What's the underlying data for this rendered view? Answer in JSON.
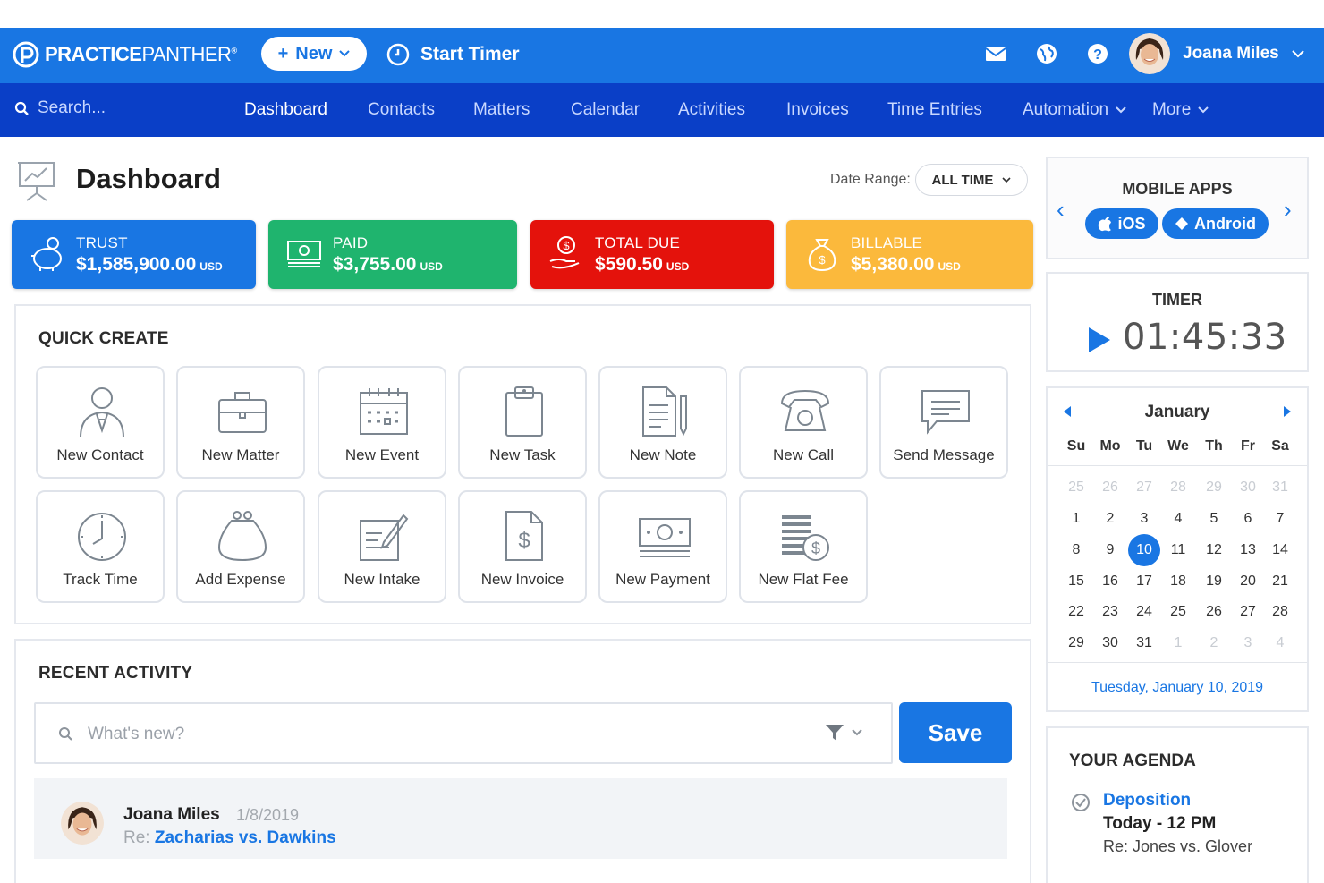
{
  "header": {
    "logo_bold": "PRACTICE",
    "logo_thin": "PANTHER",
    "logo_mark": "®",
    "new_label": "New",
    "start_timer_label": "Start Timer",
    "user_name": "Joana Miles"
  },
  "nav": {
    "search_placeholder": "Search...",
    "items": [
      "Dashboard",
      "Contacts",
      "Matters",
      "Calendar",
      "Activities",
      "Invoices",
      "Time Entries",
      "Automation",
      "More"
    ],
    "active": "Dashboard"
  },
  "dashboard": {
    "title": "Dashboard",
    "date_range_label": "Date Range:",
    "date_range_value": "ALL TIME"
  },
  "stats": [
    {
      "label": "TRUST",
      "value": "$1,585,900.00",
      "unit": "USD",
      "color": "#1976e3"
    },
    {
      "label": "PAID",
      "value": "$3,755.00",
      "unit": "USD",
      "color": "#1fb46e"
    },
    {
      "label": "TOTAL DUE",
      "value": "$590.50",
      "unit": "USD",
      "color": "#e4120c"
    },
    {
      "label": "BILLABLE",
      "value": "$5,380.00",
      "unit": "USD",
      "color": "#fbb93c"
    }
  ],
  "quick_create": {
    "title": "QUICK CREATE",
    "tiles": [
      {
        "label": "New Contact",
        "icon": "contact-icon"
      },
      {
        "label": "New Matter",
        "icon": "briefcase-icon"
      },
      {
        "label": "New Event",
        "icon": "calendar-grid-icon"
      },
      {
        "label": "New Task",
        "icon": "clipboard-icon"
      },
      {
        "label": "New Note",
        "icon": "note-pencil-icon"
      },
      {
        "label": "New Call",
        "icon": "telephone-icon"
      },
      {
        "label": "Send Message",
        "icon": "speech-bubble-icon"
      },
      {
        "label": "Track Time",
        "icon": "clock-icon"
      },
      {
        "label": "Add Expense",
        "icon": "coin-purse-icon"
      },
      {
        "label": "New Intake",
        "icon": "form-edit-icon"
      },
      {
        "label": "New Invoice",
        "icon": "invoice-dollar-icon"
      },
      {
        "label": "New Payment",
        "icon": "banknote-icon"
      },
      {
        "label": "New Flat Fee",
        "icon": "coin-stack-icon"
      }
    ]
  },
  "recent_activity": {
    "title": "RECENT ACTIVITY",
    "input_placeholder": "What's new?",
    "save_label": "Save",
    "item": {
      "name": "Joana Miles",
      "date": "1/8/2019",
      "re_prefix": "Re:",
      "matter": "Zacharias vs. Dawkins"
    }
  },
  "mobile_apps": {
    "title": "MOBILE APPS",
    "ios_label": "iOS",
    "android_label": "Android"
  },
  "timer": {
    "title": "TIMER",
    "value": "01:45:33"
  },
  "calendar": {
    "month": "January",
    "weekdays": [
      "Su",
      "Mo",
      "Tu",
      "We",
      "Th",
      "Fr",
      "Sa"
    ],
    "weeks": [
      [
        "25",
        "26",
        "27",
        "28",
        "29",
        "30",
        "31"
      ],
      [
        "1",
        "2",
        "3",
        "4",
        "5",
        "6",
        "7"
      ],
      [
        "8",
        "9",
        "10",
        "11",
        "12",
        "13",
        "14"
      ],
      [
        "15",
        "16",
        "17",
        "18",
        "19",
        "20",
        "21"
      ],
      [
        "22",
        "23",
        "24",
        "25",
        "26",
        "27",
        "28"
      ],
      [
        "29",
        "30",
        "31",
        "1",
        "2",
        "3",
        "4"
      ]
    ],
    "selected_day": "10",
    "footer": "Tuesday, January 10, 2019"
  },
  "agenda": {
    "title": "YOUR AGENDA",
    "event": "Deposition",
    "when": "Today - 12 PM",
    "re": "Re: Jones vs. Glover"
  },
  "colors": {
    "brand_blue": "#1976e3",
    "nav_blue": "#0a3fc7"
  }
}
